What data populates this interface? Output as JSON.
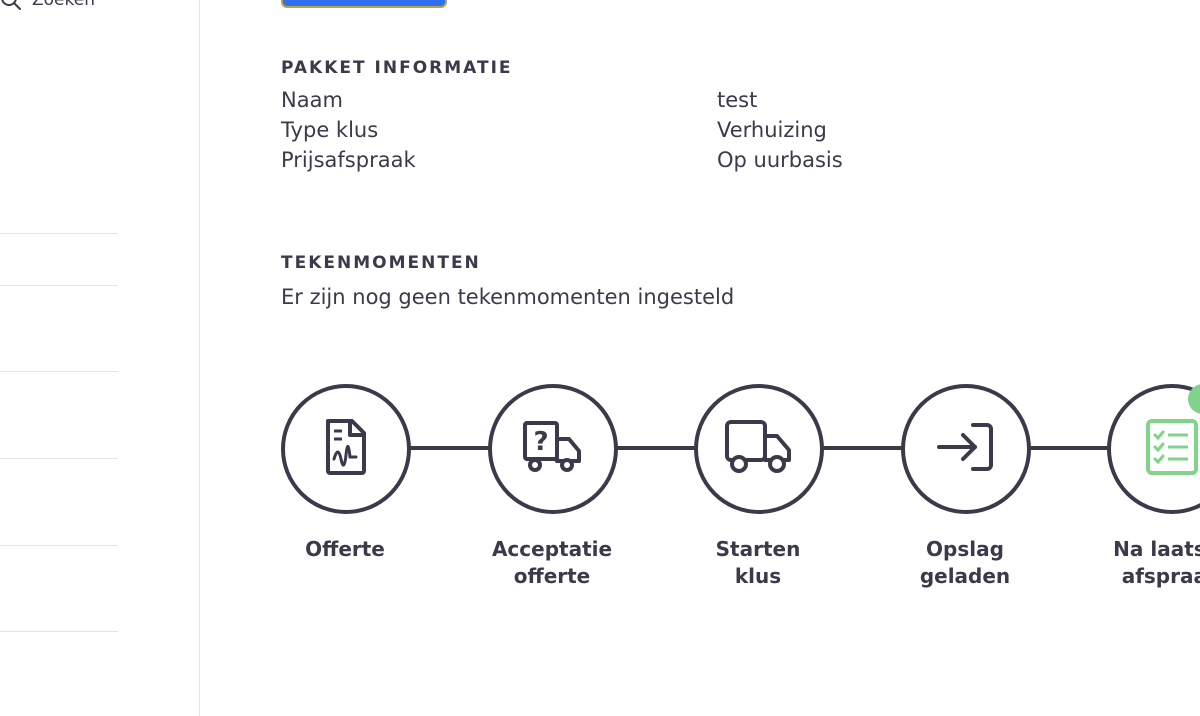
{
  "sidebar": {
    "search_label": "Zoeken"
  },
  "package_info": {
    "title": "PAKKET INFORMATIE",
    "rows": [
      {
        "label": "Naam",
        "value": "test"
      },
      {
        "label": "Type klus",
        "value": "Verhuizing"
      },
      {
        "label": "Prijsafspraak",
        "value": "Op uurbasis"
      }
    ]
  },
  "sign_moments": {
    "title": "TEKENMOMENTEN",
    "empty_text": "Er zijn nog geen tekenmomenten ingesteld"
  },
  "steps": [
    {
      "line1": "Offerte",
      "line2": "",
      "icon": "document-signature-icon"
    },
    {
      "line1": "Acceptatie",
      "line2": "offerte",
      "icon": "truck-question-icon"
    },
    {
      "line1": "Starten",
      "line2": "klus",
      "icon": "truck-icon"
    },
    {
      "line1": "Opslag",
      "line2": "geladen",
      "icon": "enter-arrow-icon"
    },
    {
      "line1": "Na laatste",
      "line2": "afspraak",
      "icon": "checklist-icon"
    }
  ],
  "colors": {
    "primary_text": "#3b3a4a",
    "button_blue": "#2f6ff0",
    "green_accent": "#7fd38a"
  }
}
